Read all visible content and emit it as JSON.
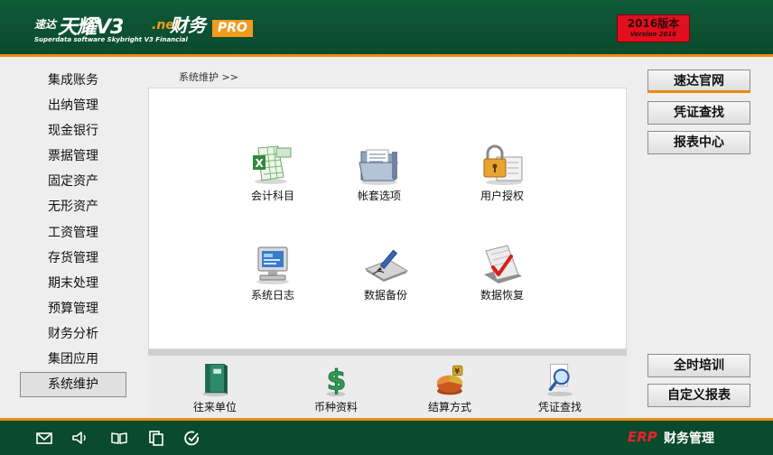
{
  "header": {
    "brand": "速达",
    "title": "天耀V3",
    "net": ".net",
    "suffix": "财务",
    "subtitle": "Superdata software Skybright V3 Financial",
    "pro": "PRO",
    "version_main": "2016版本",
    "version_sub": "Version 2016"
  },
  "sidebar": {
    "items": [
      {
        "label": "集成账务"
      },
      {
        "label": "出纳管理"
      },
      {
        "label": "现金银行"
      },
      {
        "label": "票据管理"
      },
      {
        "label": "固定资产"
      },
      {
        "label": "无形资产"
      },
      {
        "label": "工资管理"
      },
      {
        "label": "存货管理"
      },
      {
        "label": "期末处理"
      },
      {
        "label": "预算管理"
      },
      {
        "label": "财务分析"
      },
      {
        "label": "集团应用"
      },
      {
        "label": "系统维护",
        "selected": true
      }
    ]
  },
  "breadcrumb": "系统维护 >>",
  "main": {
    "tiles": [
      {
        "label": "会计科目",
        "icon": "spreadsheet-icon"
      },
      {
        "label": "帐套选项",
        "icon": "folder-icon"
      },
      {
        "label": "用户授权",
        "icon": "lock-icon"
      },
      {
        "label": "系统日志",
        "icon": "monitor-icon"
      },
      {
        "label": "数据备份",
        "icon": "backup-pen-icon"
      },
      {
        "label": "数据恢复",
        "icon": "restore-check-icon"
      }
    ]
  },
  "bottom": {
    "tiles": [
      {
        "label": "往来单位",
        "icon": "binder-icon"
      },
      {
        "label": "币种资料",
        "icon": "currency-icon"
      },
      {
        "label": "结算方式",
        "icon": "pie-chart-icon"
      },
      {
        "label": "凭证查找",
        "icon": "magnifier-icon"
      }
    ]
  },
  "right": {
    "top_buttons": [
      "速达官网",
      "凭证查找",
      "报表中心"
    ],
    "bottom_buttons": [
      "全时培训",
      "自定义报表"
    ]
  },
  "footer": {
    "icons": [
      "mail-icon",
      "speaker-icon",
      "book-icon",
      "copy-icon",
      "refresh-check-icon"
    ],
    "erp": "ERP",
    "label": "财务管理"
  },
  "colors": {
    "header_bg": "#0a4a2d",
    "accent_orange": "#e98a14",
    "version_red": "#e10f1f"
  }
}
